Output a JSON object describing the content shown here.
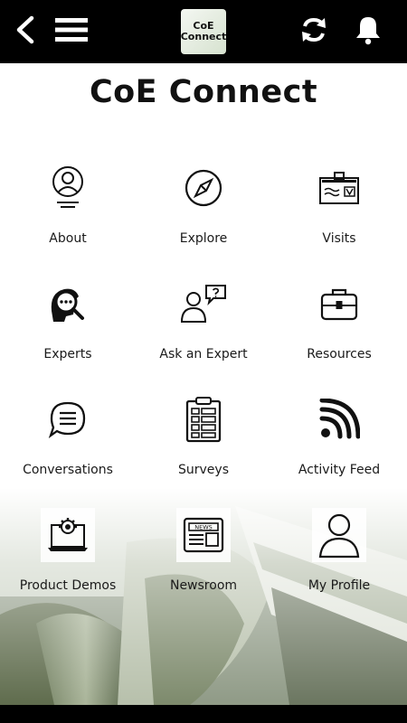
{
  "header": {
    "logo_line1": "CoE",
    "logo_line2": "Connect"
  },
  "app_title": "CoE Connect",
  "tiles": [
    {
      "label": "About",
      "icon": "person-circle-icon"
    },
    {
      "label": "Explore",
      "icon": "compass-icon"
    },
    {
      "label": "Visits",
      "icon": "badge-icon"
    },
    {
      "label": "Experts",
      "icon": "expert-search-icon"
    },
    {
      "label": "Ask an Expert",
      "icon": "person-question-icon"
    },
    {
      "label": "Resources",
      "icon": "briefcase-icon"
    },
    {
      "label": "Conversations",
      "icon": "chat-bubble-icon"
    },
    {
      "label": "Surveys",
      "icon": "clipboard-icon"
    },
    {
      "label": "Activity Feed",
      "icon": "rss-icon"
    },
    {
      "label": "Product Demos",
      "icon": "laptop-gear-icon"
    },
    {
      "label": "Newsroom",
      "icon": "newspaper-icon"
    },
    {
      "label": "My Profile",
      "icon": "user-icon"
    }
  ],
  "colors": {
    "topbar": "#000000",
    "background": "#ffffff",
    "text": "#1a1a1a"
  }
}
